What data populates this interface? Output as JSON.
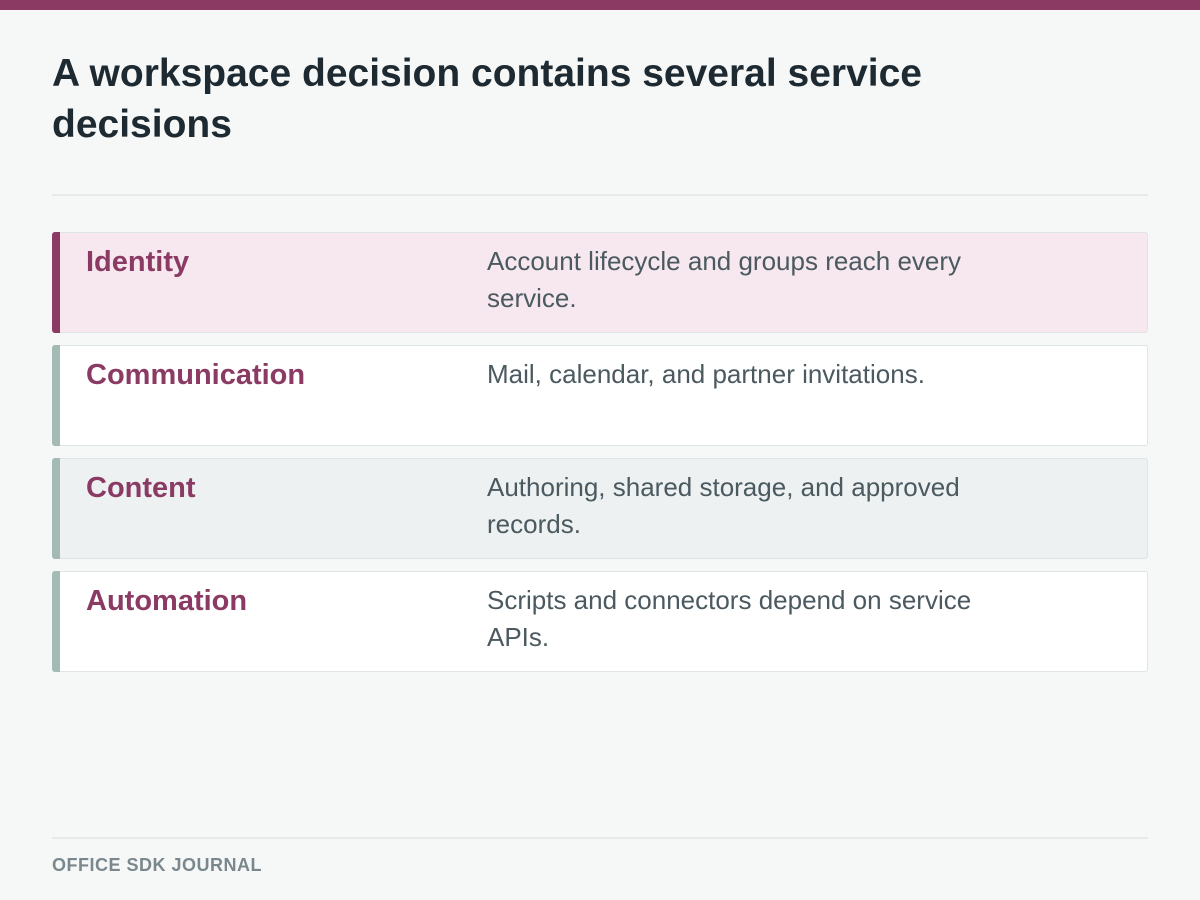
{
  "page": {
    "title": "A workspace decision contains several service decisions",
    "footer": "OFFICE SDK JOURNAL"
  },
  "rows": [
    {
      "label": "Identity",
      "description": "Account lifecycle and groups reach every service.",
      "highlighted": true
    },
    {
      "label": "Communication",
      "description": "Mail, calendar, and partner invitations.",
      "highlighted": false
    },
    {
      "label": "Content",
      "description": "Authoring, shared storage, and approved records.",
      "highlighted": false
    },
    {
      "label": "Automation",
      "description": "Scripts and connectors depend on service APIs.",
      "highlighted": false
    }
  ],
  "colors": {
    "accent": "#8a3a63",
    "secondary_accent": "#a3bbb4",
    "highlight_background": "#f6e8ee",
    "title_text": "#1e2a31",
    "body_text": "#4b5960"
  }
}
